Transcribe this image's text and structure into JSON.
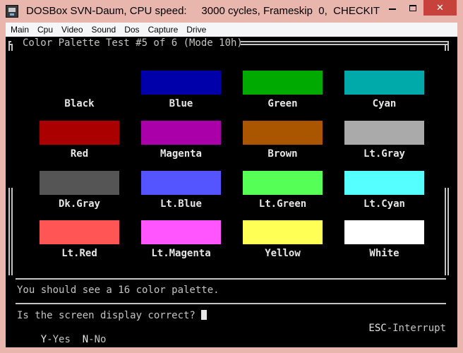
{
  "window": {
    "title": "DOSBox SVN-Daum, CPU speed:     3000 cycles, Frameskip  0,  CHECKIT",
    "close_glyph": "✕"
  },
  "menu": [
    "Main",
    "Cpu",
    "Video",
    "Sound",
    "Dos",
    "Capture",
    "Drive"
  ],
  "screen": {
    "caption": "Color Palette Test #5 of 6 (Mode 10h)",
    "colors": [
      {
        "label": "Black",
        "color": "#000000"
      },
      {
        "label": "Blue",
        "color": "#0000aa"
      },
      {
        "label": "Green",
        "color": "#00aa00"
      },
      {
        "label": "Cyan",
        "color": "#00aaaa"
      },
      {
        "label": "Red",
        "color": "#aa0000"
      },
      {
        "label": "Magenta",
        "color": "#aa00aa"
      },
      {
        "label": "Brown",
        "color": "#aa5500"
      },
      {
        "label": "Lt.Gray",
        "color": "#aaaaaa"
      },
      {
        "label": "Dk.Gray",
        "color": "#555555"
      },
      {
        "label": "Lt.Blue",
        "color": "#5555ff"
      },
      {
        "label": "Lt.Green",
        "color": "#55ff55"
      },
      {
        "label": "Lt.Cyan",
        "color": "#55ffff"
      },
      {
        "label": "Lt.Red",
        "color": "#ff5555"
      },
      {
        "label": "Lt.Magenta",
        "color": "#ff55ff"
      },
      {
        "label": "Yellow",
        "color": "#ffff55"
      },
      {
        "label": "White",
        "color": "#ffffff"
      }
    ],
    "message": "You should see a 16 color palette.",
    "question": "Is the screen display correct? ",
    "yes_key": "Y",
    "yes_label": "-Yes",
    "no_key": "N",
    "no_label": "-No",
    "esc_key": "ESC",
    "esc_label": "-Interrupt"
  }
}
